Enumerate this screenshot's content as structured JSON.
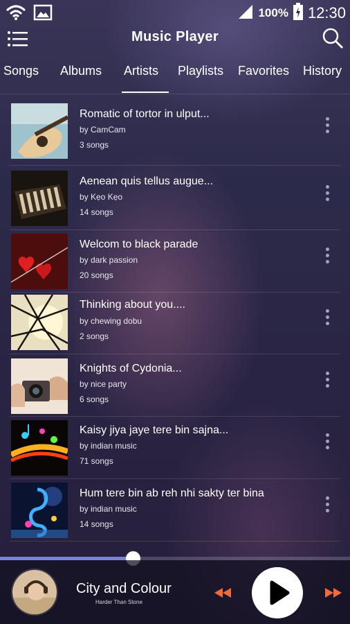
{
  "status_bar": {
    "battery": "100%",
    "time": "12:30"
  },
  "app_bar": {
    "title": "Music Player"
  },
  "tabs": [
    {
      "label": "Songs",
      "active": false
    },
    {
      "label": "Albums",
      "active": false
    },
    {
      "label": "Artists",
      "active": true
    },
    {
      "label": "Playlists",
      "active": false
    },
    {
      "label": "Favorites",
      "active": false
    },
    {
      "label": "History",
      "active": false
    }
  ],
  "artists": [
    {
      "title": "Romatic of tortor in ulput...",
      "artist": "by CamCam",
      "count": "3 songs",
      "thumb": "guitar"
    },
    {
      "title": "Aenean quis tellus augue...",
      "artist": "by Kẹo Kẹo",
      "count": "14 songs",
      "thumb": "piano"
    },
    {
      "title": "Welcom to black parade",
      "artist": "by dark passion",
      "count": "20 songs",
      "thumb": "hearts"
    },
    {
      "title": "Thinking about you....",
      "artist": "by chewing dobu",
      "count": "2 songs",
      "thumb": "branches"
    },
    {
      "title": "Knights of Cydonia...",
      "artist": "by nice party",
      "count": "6 songs",
      "thumb": "camera"
    },
    {
      "title": "Kaisy jiya jaye tere bin sajna...",
      "artist": "by indian music",
      "count": "71 songs",
      "thumb": "notes"
    },
    {
      "title": "Hum tere bin ab reh nhi sakty ter bina",
      "artist": "by indian music",
      "count": "14 songs",
      "thumb": "clef"
    }
  ],
  "now_playing": {
    "title": "City and Colour",
    "subtitle": "Harder Than Stone",
    "progress": 0.38
  },
  "colors": {
    "accent": "#7a82d8",
    "more_dots": "#a7a4b8",
    "next_prev": "#f06a3a"
  },
  "icons": [
    "wifi-icon",
    "image-icon",
    "signal-icon",
    "battery-icon",
    "menu-icon",
    "search-icon",
    "more-vert-icon",
    "rewind-icon",
    "play-icon",
    "fast-forward-icon"
  ]
}
